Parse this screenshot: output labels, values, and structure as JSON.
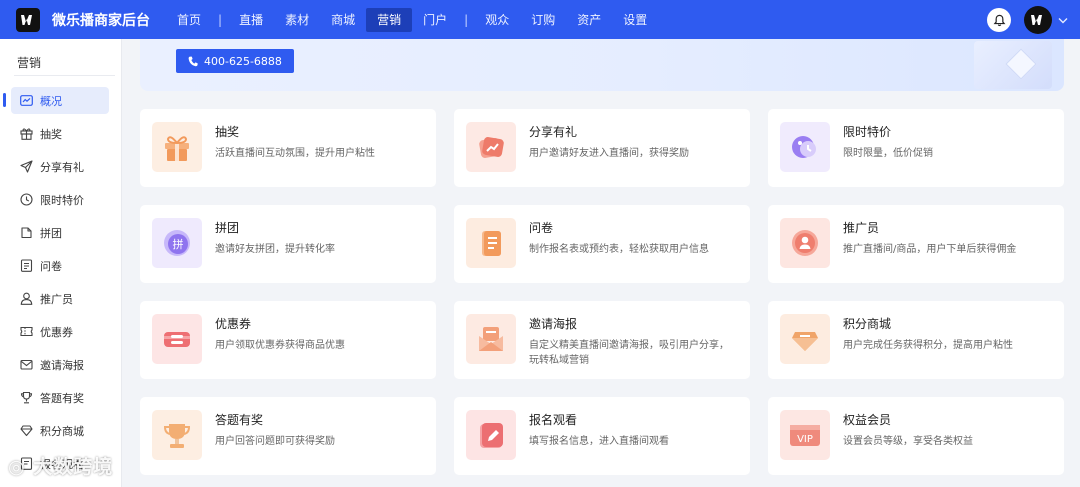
{
  "app": {
    "title": "微乐播商家后台"
  },
  "nav": {
    "items": [
      {
        "label": "首页"
      },
      {
        "label": "直播"
      },
      {
        "label": "素材"
      },
      {
        "label": "商城"
      },
      {
        "label": "营销",
        "active": true
      },
      {
        "label": "门户"
      },
      {
        "label": "观众"
      },
      {
        "label": "订购"
      },
      {
        "label": "资产"
      },
      {
        "label": "设置"
      }
    ]
  },
  "sidebar": {
    "title": "营销",
    "items": [
      {
        "label": "概况",
        "icon": "overview-icon",
        "active": true
      },
      {
        "label": "抽奖",
        "icon": "gift-icon"
      },
      {
        "label": "分享有礼",
        "icon": "send-icon"
      },
      {
        "label": "限时特价",
        "icon": "clock-icon"
      },
      {
        "label": "拼团",
        "icon": "group-icon"
      },
      {
        "label": "问卷",
        "icon": "survey-icon"
      },
      {
        "label": "推广员",
        "icon": "user-icon"
      },
      {
        "label": "优惠券",
        "icon": "coupon-icon"
      },
      {
        "label": "邀请海报",
        "icon": "mail-icon"
      },
      {
        "label": "答题有奖",
        "icon": "trophy-icon"
      },
      {
        "label": "积分商城",
        "icon": "diamond-icon"
      },
      {
        "label": "报名观看",
        "icon": "signup-icon"
      }
    ]
  },
  "banner": {
    "phone": "400-625-6888"
  },
  "cards": [
    {
      "title": "抽奖",
      "desc": "活跃直播间互动氛围，提升用户粘性",
      "icon": "gift-box-icon",
      "color": "#f4a46b"
    },
    {
      "title": "分享有礼",
      "desc": "用户邀请好友进入直播间，获得奖励",
      "icon": "share-card-icon",
      "color": "#ee7b6a"
    },
    {
      "title": "限时特价",
      "desc": "限时限量，低价促销",
      "icon": "moon-clock-icon",
      "color": "#9a7ef2"
    },
    {
      "title": "拼团",
      "desc": "邀请好友拼团，提升转化率",
      "icon": "pin-badge-icon",
      "color": "#8f74ef"
    },
    {
      "title": "问卷",
      "desc": "制作报名表或预约表，轻松获取用户信息",
      "icon": "notebook-icon",
      "color": "#f29a5c"
    },
    {
      "title": "推广员",
      "desc": "推广直播间/商品，用户下单后获得佣金",
      "icon": "promoter-icon",
      "color": "#ef7e6e"
    },
    {
      "title": "优惠券",
      "desc": "用户领取优惠券获得商品优惠",
      "icon": "ticket-icon",
      "color": "#ee6f73"
    },
    {
      "title": "邀请海报",
      "desc": "自定义精美直播间邀请海报，吸引用户分享，玩转私域营销",
      "icon": "envelope-icon",
      "color": "#f3a07a"
    },
    {
      "title": "积分商城",
      "desc": "用户完成任务获得积分，提高用户粘性",
      "icon": "gem-icon",
      "color": "#f0a469"
    },
    {
      "title": "答题有奖",
      "desc": "用户回答问题即可获得奖励",
      "icon": "cup-icon",
      "color": "#f3ae73"
    },
    {
      "title": "报名观看",
      "desc": "填写报名信息，进入直播间观看",
      "icon": "pen-note-icon",
      "color": "#ec6f72"
    },
    {
      "title": "权益会员",
      "desc": "设置会员等级，享受各类权益",
      "icon": "vip-card-icon",
      "color": "#ef8a7c",
      "badge": "VIP"
    }
  ],
  "watermark": {
    "text": "大数跨境"
  }
}
